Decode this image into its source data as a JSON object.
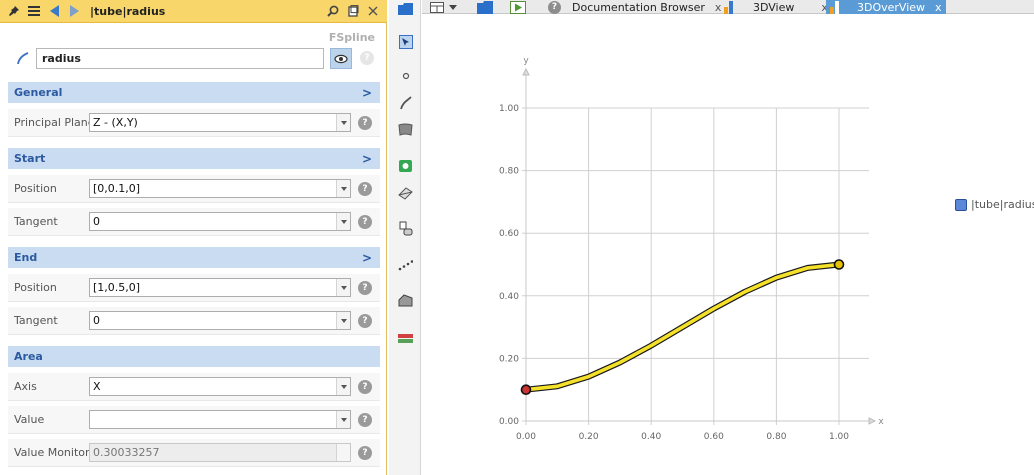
{
  "panel": {
    "title": "|tube|radius",
    "type": "FSpline",
    "name_value": "radius",
    "sections": [
      {
        "title": "General",
        "rows": [
          {
            "label": "Principal Plane",
            "value": "Z - (X,Y)"
          }
        ]
      },
      {
        "title": "Start",
        "rows": [
          {
            "label": "Position",
            "value": "[0,0.1,0]"
          },
          {
            "label": "Tangent",
            "value": "0"
          }
        ]
      },
      {
        "title": "End",
        "rows": [
          {
            "label": "Position",
            "value": "[1,0.5,0]"
          },
          {
            "label": "Tangent",
            "value": "0"
          }
        ]
      },
      {
        "title": "Area",
        "rows": [
          {
            "label": "Axis",
            "value": "X"
          },
          {
            "label": "Value",
            "value": ""
          },
          {
            "label": "Value Monitor",
            "value": "0.30033257"
          }
        ]
      }
    ],
    "chevron": ">",
    "help_glyph": "?"
  },
  "tabs": [
    {
      "label": "Documentation Browser",
      "close": "x"
    },
    {
      "label": "3DView",
      "close": "x"
    },
    {
      "label": "3DOverView",
      "close": "x"
    }
  ],
  "chart_data": {
    "type": "line",
    "xlabel": "x",
    "ylabel": "y",
    "xlim": [
      0,
      1
    ],
    "ylim": [
      0,
      1
    ],
    "x_ticks": [
      "0.00",
      "0.20",
      "0.40",
      "0.60",
      "0.80",
      "1.00"
    ],
    "y_ticks": [
      "0.00",
      "0.20",
      "0.40",
      "0.60",
      "0.80",
      "1.00"
    ],
    "grid": true,
    "legend": "right",
    "series": [
      {
        "name": "|tube|radius",
        "x": [
          0,
          0.1,
          0.2,
          0.3,
          0.4,
          0.5,
          0.6,
          0.7,
          0.8,
          0.9,
          1.0
        ],
        "y": [
          0.1,
          0.111,
          0.142,
          0.187,
          0.241,
          0.3,
          0.359,
          0.413,
          0.458,
          0.489,
          0.5
        ],
        "color": "#f5e12a",
        "outline": "#1a1a1a"
      }
    ],
    "markers": [
      {
        "x": 0,
        "y": 0.1,
        "fill": "#cc3333"
      },
      {
        "x": 1,
        "y": 0.5,
        "fill": "#e6c100"
      }
    ]
  }
}
